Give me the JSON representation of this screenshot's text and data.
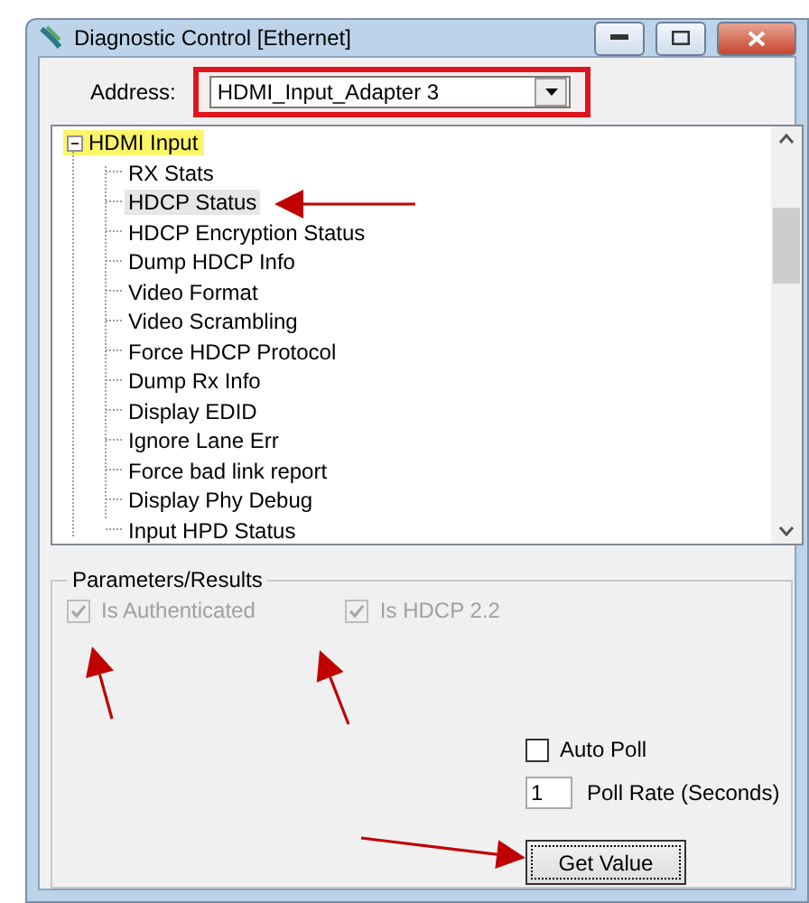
{
  "window": {
    "title": "Diagnostic Control [Ethernet]"
  },
  "address": {
    "label": "Address:",
    "value": "HDMI_Input_Adapter 3"
  },
  "tree": {
    "items": [
      {
        "label": "HDMI Input",
        "expanded": true,
        "highlighted": true,
        "selected": false,
        "children": [
          {
            "label": "RX Stats",
            "selected": false
          },
          {
            "label": "HDCP Status",
            "selected": true
          },
          {
            "label": "HDCP Encryption Status",
            "selected": false
          },
          {
            "label": "Dump HDCP Info",
            "selected": false
          },
          {
            "label": "Video Format",
            "selected": false
          },
          {
            "label": "Video Scrambling",
            "selected": false
          },
          {
            "label": "Force HDCP Protocol",
            "selected": false
          },
          {
            "label": "Dump Rx Info",
            "selected": false
          },
          {
            "label": "Display EDID",
            "selected": false
          },
          {
            "label": "Ignore Lane Err",
            "selected": false
          },
          {
            "label": "Force bad link report",
            "selected": false
          },
          {
            "label": "Display Phy Debug",
            "selected": false
          },
          {
            "label": "Input HPD Status",
            "selected": false
          }
        ]
      }
    ]
  },
  "parameters": {
    "title": "Parameters/Results",
    "results": [
      {
        "label": "Is Authenticated",
        "checked": true,
        "disabled": true
      },
      {
        "label": "Is HDCP 2.2",
        "checked": true,
        "disabled": true
      }
    ],
    "auto_poll": {
      "label": "Auto Poll",
      "checked": false
    },
    "poll_rate": {
      "value": "1",
      "label": "Poll Rate (Seconds)"
    },
    "button": "Get Value"
  }
}
